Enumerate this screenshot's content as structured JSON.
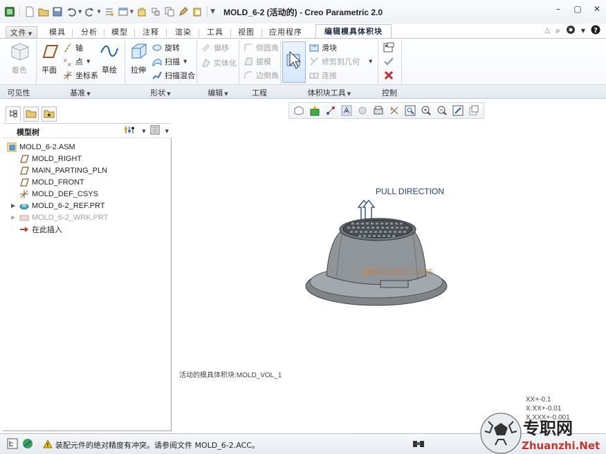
{
  "window": {
    "title": "MOLD_6-2 (活动的) - Creo Parametric 2.0"
  },
  "tabs": {
    "file": "文件",
    "items": [
      "模具",
      "分析",
      "模型",
      "注释",
      "渲染",
      "工具",
      "视图",
      "应用程序"
    ],
    "active": "编辑模具体积块"
  },
  "ribbon": {
    "shading": "着色",
    "plane": "平面",
    "axis": "轴",
    "point": "点",
    "csys": "坐标系",
    "sketch": "草绘",
    "extrude": "拉伸",
    "revolve": "旋转",
    "sweep": "扫描",
    "swept_blend": "扫描混合",
    "offset": "偏移",
    "solidify": "实体化",
    "round": "倒圆角",
    "draft": "拔模",
    "chamfer": "边倒角",
    "slide": "滑块",
    "trim_to_geom": "修剪到几何",
    "join": "连接",
    "groups": {
      "visibility": "可见性",
      "datum": "基准",
      "shapes": "形状",
      "editing": "编辑",
      "engineering": "工程",
      "volume_tools": "体积块工具",
      "control": "控制"
    }
  },
  "model_tree": {
    "title": "模型树",
    "items": [
      {
        "label": "MOLD_6-2.ASM",
        "icon": "assembly-icon",
        "dimmed": false
      },
      {
        "label": "MOLD_RIGHT",
        "icon": "datum-plane-icon",
        "dimmed": false
      },
      {
        "label": "MAIN_PARTING_PLN",
        "icon": "datum-plane-icon",
        "dimmed": false
      },
      {
        "label": "MOLD_FRONT",
        "icon": "datum-plane-icon",
        "dimmed": false
      },
      {
        "label": "MOLD_DEF_CSYS",
        "icon": "csys-icon",
        "dimmed": false
      },
      {
        "label": "MOLD_6-2_REF.PRT",
        "icon": "part-icon",
        "dimmed": false
      },
      {
        "label": "MOLD_6-2_WRK.PRT",
        "icon": "workpiece-icon",
        "dimmed": true
      },
      {
        "label": "在此插入",
        "icon": "insert-here-icon",
        "dimmed": false
      }
    ]
  },
  "graphics": {
    "pull_direction": "PULL DIRECTION",
    "csys_label": "MOLD_DEF_CSYS",
    "active_volume": "活动的模具体积块:MOLD_VOL_1",
    "accuracy": [
      "XX+-0.1",
      "X.XX+-0.01",
      "X.XXX+-0.001"
    ]
  },
  "status": {
    "message": "装配元件的绝对精度有冲突。请参阅文件 MOLD_6-2.ACC。"
  },
  "watermark": {
    "cn": "专职网",
    "url": "Zhuanzhi.Net"
  },
  "colors": {
    "accent": "#1a5fb4",
    "datum_plane": "#8a5a2b",
    "accept_check": "#9aa3ad",
    "cancel_x": "#c62828",
    "insert_arrow": "#c0392b",
    "pull_text": "#1f3a8a",
    "csys_text": "#c47a3a"
  }
}
